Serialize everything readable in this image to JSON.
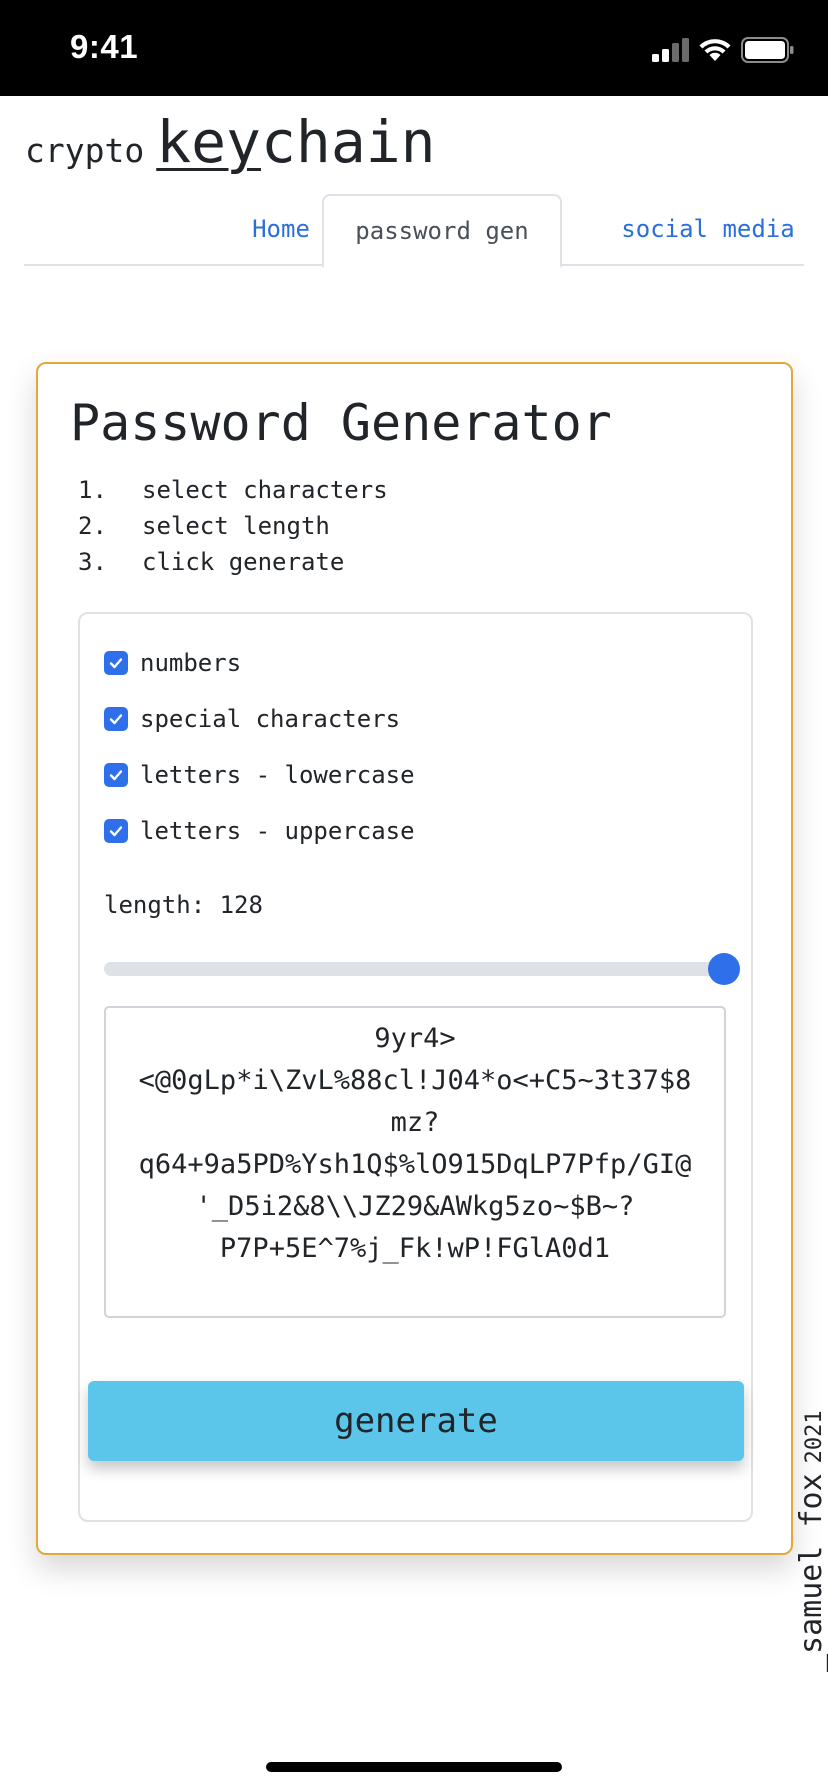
{
  "status_bar": {
    "time": "9:41",
    "icons": [
      "signal-icon",
      "wifi-icon",
      "battery-icon"
    ]
  },
  "header": {
    "brand_small": "crypto",
    "brand_large_underlined": "key",
    "brand_large_rest": "chain"
  },
  "tabs": [
    {
      "label": "Home",
      "active": false
    },
    {
      "label": "password gen",
      "active": true
    },
    {
      "label": "social media",
      "active": false
    }
  ],
  "generator": {
    "title": "Password Generator",
    "steps": [
      {
        "num": "1.",
        "text": "select characters"
      },
      {
        "num": "2.",
        "text": "select length"
      },
      {
        "num": "3.",
        "text": "click generate"
      }
    ],
    "options": [
      {
        "label": "numbers",
        "checked": true
      },
      {
        "label": "special characters",
        "checked": true
      },
      {
        "label": "letters - lowercase",
        "checked": true
      },
      {
        "label": "letters - uppercase",
        "checked": true
      }
    ],
    "length_label": "length: 128",
    "slider_fraction": 1.0,
    "output": "9yr4>\n<@0gLp*i\\ZvL%88cl!J04*o<+C5~3t37$8\nmz?\nq64+9a5PD%Ysh1Q$%lO915DqLP7Pfp/GI@\n'_D5i2&8\\\\JZ29&AWkg5zo~$B~?\nP7P+5E^7%j_Fk!wP!FGlA0d1",
    "generate_label": "generate"
  },
  "signature": {
    "name": "_samuel fox",
    "year": "2021"
  },
  "colors": {
    "accent_blue": "#2f6fea",
    "link_blue": "#2a6fdb",
    "card_border": "#e5a73b",
    "button_bg": "#5bc6ea"
  }
}
